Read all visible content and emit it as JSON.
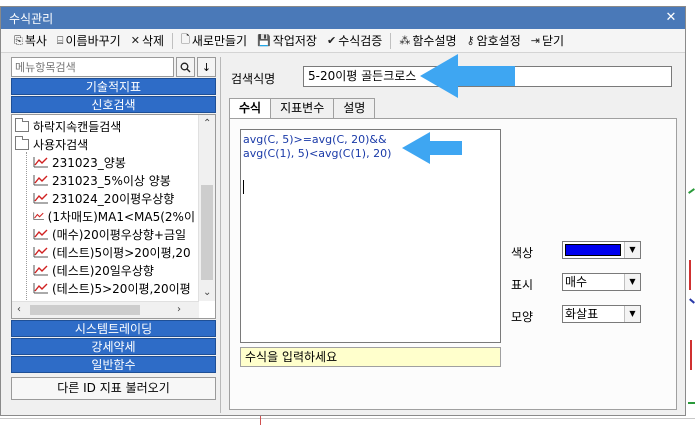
{
  "window": {
    "title": "수식관리",
    "close_glyph": "✕"
  },
  "toolbar": [
    {
      "id": "copy",
      "label": "복사",
      "icon": "copy-icon",
      "glyph": "⎘"
    },
    {
      "id": "rename",
      "label": "이름바꾸기",
      "icon": "rename-icon",
      "glyph": "⌸"
    },
    {
      "id": "delete",
      "label": "삭제",
      "icon": "delete-icon",
      "glyph": "✕"
    },
    {
      "id": "new",
      "label": "새로만들기",
      "icon": "new-file-icon",
      "glyph": "🗋"
    },
    {
      "id": "save",
      "label": "작업저장",
      "icon": "save-icon",
      "glyph": "💾"
    },
    {
      "id": "verify",
      "label": "수식검증",
      "icon": "check-icon",
      "glyph": "✔"
    },
    {
      "id": "funchelp",
      "label": "함수설명",
      "icon": "wand-icon",
      "glyph": "⁂"
    },
    {
      "id": "password",
      "label": "암호설정",
      "icon": "key-icon",
      "glyph": "⚷"
    },
    {
      "id": "close",
      "label": "닫기",
      "icon": "door-exit-icon",
      "glyph": "⇥"
    }
  ],
  "left": {
    "search_placeholder": "메뉴항목검색",
    "top_categories": [
      "기술적지표",
      "신호검색"
    ],
    "tree": {
      "folders": [
        "하락지속캔들검색",
        "사용자검색"
      ],
      "items": [
        "231023_양봉",
        "231023_5%이상 양봉",
        "231024_20이평우상향",
        "(1차매도)MA1<MA5(2%이",
        "(매수)20이평우상향+금일",
        "(테스트)5이평>20이평,20",
        "(테스트)20일우상향",
        "(테스트)5>20이평,20이평"
      ]
    },
    "bottom_categories": [
      "시스템트레이딩",
      "강세약세",
      "일반함수"
    ],
    "load_button": "다른 ID 지표 불러오기"
  },
  "right": {
    "name_label": "검색식명",
    "name_value": "5-20이평 골든크로스",
    "tabs": [
      "수식",
      "지표변수",
      "설명"
    ],
    "formula_lines": [
      "avg(C, 5)>=avg(C, 20)&&",
      "avg(C(1), 5)<avg(C(1), 20)"
    ],
    "hint": "수식을 입력하세요",
    "props": {
      "color_label": "색상",
      "color_value": "#0000ee",
      "display_label": "표시",
      "display_value": "매수",
      "shape_label": "모양",
      "shape_value": "화살표"
    }
  },
  "accent": {
    "category_blue": "#2e6cc7",
    "callout_blue": "#3ea6f2",
    "title_blue": "#4a79b8"
  }
}
